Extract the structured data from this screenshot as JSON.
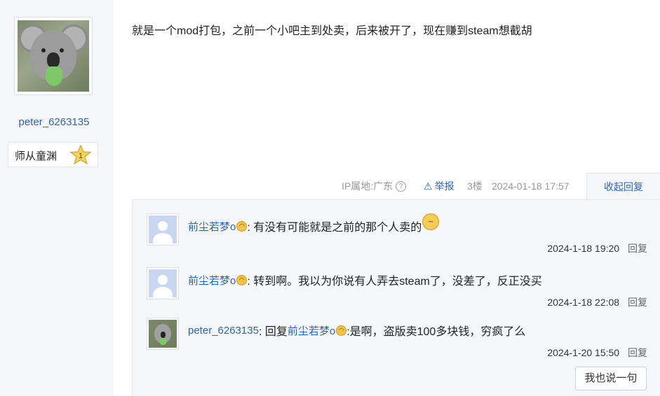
{
  "author": {
    "username": "peter_6263135",
    "badge": {
      "label": "师从童渊",
      "level": "1"
    }
  },
  "post": {
    "content": "就是一个mod打包，之前一个小吧主到处卖，后来被开了，现在赚到steam想截胡",
    "ip_label": "IP属地:广东",
    "help_glyph": "?",
    "report_icon_glyph": "⚠",
    "report_label": "举报",
    "floor": "3楼",
    "time": "2024-01-18 17:57",
    "collapse_label": "收起回复"
  },
  "replies": [
    {
      "user": "前尘若梦o",
      "text": ": 有没有可能就是之前的那个人卖的",
      "time": "2024-1-18 19:20",
      "reply_label": "回复"
    },
    {
      "user": "前尘若梦o",
      "text": ": 转到啊。我以为你说有人弄去steam了，没差了，反正没买",
      "time": "2024-1-18 22:08",
      "reply_label": "回复"
    },
    {
      "user": "peter_6263135",
      "prefix": ": 回复 ",
      "target_user": "前尘若梦o",
      "text": " :是啊，盗版卖100多块钱，穷疯了么",
      "time": "2024-1-20 15:50",
      "reply_label": "回复"
    }
  ],
  "say_button_label": "我也说一句",
  "icons": {
    "laugh_emoji": "😂",
    "thinking_emoji": "🤔"
  },
  "colors": {
    "link": "#2d64b3",
    "panel_bg": "#f5f7fa"
  }
}
